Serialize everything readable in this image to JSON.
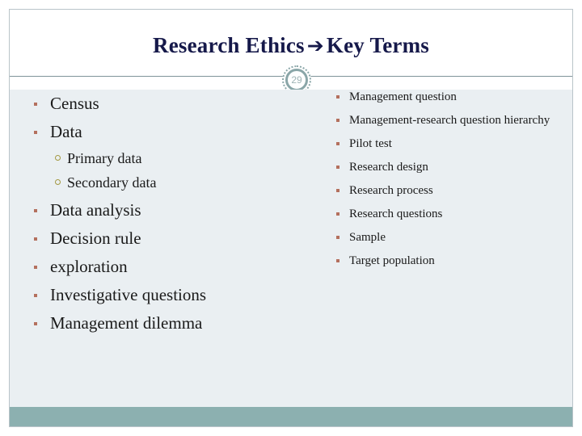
{
  "slide": {
    "title_main": "Research Ethics",
    "title_arrow": "➔",
    "title_sub": "Key Terms",
    "page_number": "29",
    "colors": {
      "title": "#16194a",
      "divider": "#7f9499",
      "body_background": "#eaeff2",
      "footer_band": "#8cb0b0",
      "bullet": "#b4705e",
      "sub_bullet": "#a39841",
      "badge_ring": "#8aa6a8"
    }
  },
  "left_column": {
    "items": [
      {
        "label": "Census",
        "children": []
      },
      {
        "label": "Data",
        "children": [
          {
            "label": "Primary data"
          },
          {
            "label": "Secondary data"
          }
        ]
      },
      {
        "label": "Data analysis",
        "children": []
      },
      {
        "label": "Decision rule",
        "children": []
      },
      {
        "label": "exploration",
        "children": []
      },
      {
        "label": "Investigative questions",
        "children": []
      },
      {
        "label": "Management dilemma",
        "children": []
      }
    ]
  },
  "right_column": {
    "items": [
      {
        "label": "Management question"
      },
      {
        "label": "Management-research question hierarchy"
      },
      {
        "label": "Pilot test"
      },
      {
        "label": "Research design"
      },
      {
        "label": "Research process"
      },
      {
        "label": "Research questions"
      },
      {
        "label": "Sample"
      },
      {
        "label": "Target population"
      }
    ]
  }
}
